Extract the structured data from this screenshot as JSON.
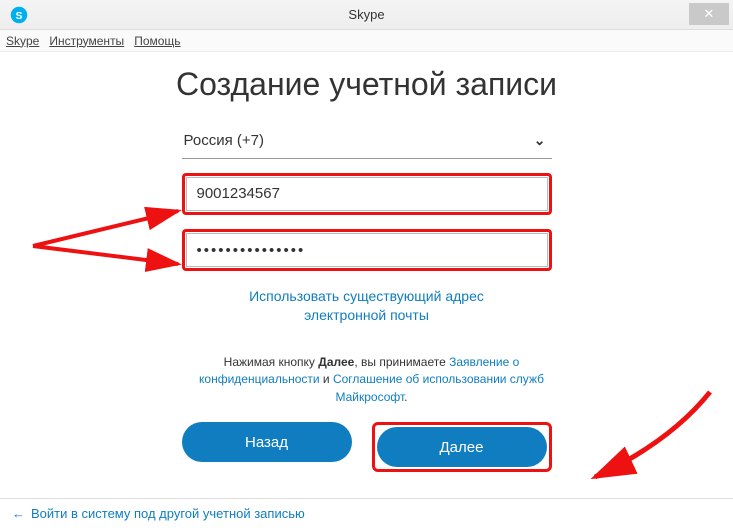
{
  "window": {
    "title": "Skype",
    "close_glyph": "✕"
  },
  "menu": {
    "skype": "Skype",
    "tools": "Инструменты",
    "help": "Помощь"
  },
  "heading": "Создание учетной записи",
  "country": {
    "label": "Россия (+7)"
  },
  "phone": {
    "value": "9001234567"
  },
  "password": {
    "masked": "•••••••••••••••"
  },
  "use_email": {
    "line1": "Использовать существующий адрес",
    "line2": "электронной почты"
  },
  "legal": {
    "prefix": "Нажимая кнопку ",
    "bold": "Далее",
    "mid": ", вы принимаете ",
    "priv": "Заявление о конфиденциальности",
    "and": " и ",
    "terms": "Соглашение об использовании служб Майкрософт",
    "dot": "."
  },
  "buttons": {
    "back": "Назад",
    "next": "Далее"
  },
  "footer": {
    "arrow": "←",
    "text": "Войти в систему под другой учетной записью"
  }
}
